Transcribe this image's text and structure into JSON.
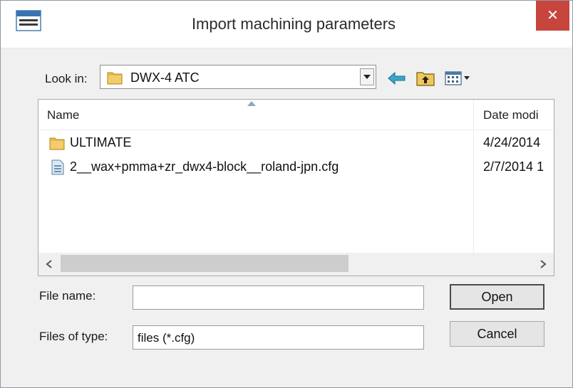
{
  "dialog": {
    "title": "Import machining parameters",
    "close_label": "✕"
  },
  "look_in": {
    "label": "Look in:",
    "value": "DWX-4 ATC"
  },
  "toolbar": {
    "icons": [
      "back-arrow-icon",
      "up-folder-icon",
      "view-menu-icon"
    ]
  },
  "file_list": {
    "columns": [
      "Name",
      "Date modi"
    ],
    "rows": [
      {
        "name": "ULTIMATE",
        "date": "4/24/2014",
        "icon": "folder-icon"
      },
      {
        "name": "2__wax+pmma+zr_dwx4-block__roland-jpn.cfg",
        "date": "2/7/2014 1",
        "icon": "cfg-file-icon"
      }
    ]
  },
  "file_name": {
    "label": "File name:",
    "value": ""
  },
  "file_type": {
    "label": "Files of type:",
    "value": "files (*.cfg)"
  },
  "buttons": {
    "open": "Open",
    "cancel": "Cancel"
  },
  "colors": {
    "close_button": "#c7453d",
    "window_bg": "#f0f0f0",
    "folder_yellow": "#e8b84a"
  }
}
